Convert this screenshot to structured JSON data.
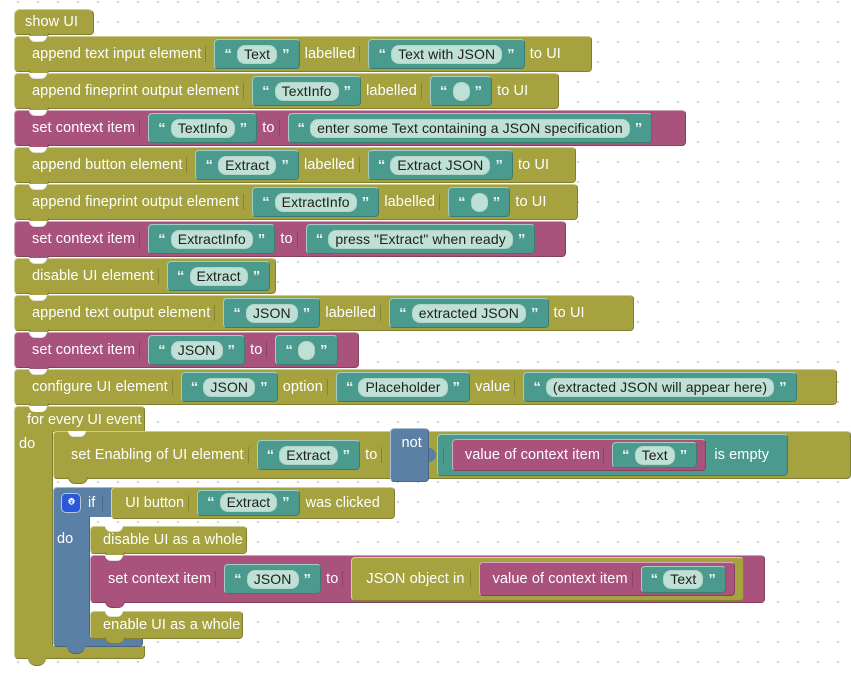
{
  "workspace": {
    "kind": "blockly-visual-program",
    "title": "show UI",
    "colors": {
      "olive": "#a5a23f",
      "magenta": "#a8527c",
      "blue": "#5b80a5",
      "teal": "#4a9b8e",
      "field": "#bfe0d5",
      "canvas": "#ffffff",
      "grid_dot": "#cfcfcf"
    }
  },
  "blocks": {
    "hat": {
      "label": "show UI"
    },
    "row_text_input": {
      "prefix": "append text input element",
      "value": "Text",
      "mid": "labelled",
      "label_value": "Text with JSON",
      "suffix": "to UI"
    },
    "row_fineprint_textinfo": {
      "prefix": "append fineprint output element",
      "value": "TextInfo",
      "mid": "labelled",
      "label_value": "",
      "suffix": "to UI"
    },
    "row_set_textinfo": {
      "prefix": "set context item",
      "value": "TextInfo",
      "mid": "to",
      "to_value": "enter some Text containing a JSON specification"
    },
    "row_button": {
      "prefix": "append button element",
      "value": "Extract",
      "mid": "labelled",
      "label_value": "Extract JSON",
      "suffix": "to UI"
    },
    "row_fineprint_extractinfo": {
      "prefix": "append fineprint output element",
      "value": "ExtractInfo",
      "mid": "labelled",
      "label_value": "",
      "suffix": "to UI"
    },
    "row_set_extractinfo": {
      "prefix": "set context item",
      "value": "ExtractInfo",
      "mid": "to",
      "to_value": "press \"Extract\" when ready"
    },
    "row_disable": {
      "prefix": "disable UI element",
      "value": "Extract"
    },
    "row_text_output": {
      "prefix": "append text output element",
      "value": "JSON",
      "mid": "labelled",
      "label_value": "extracted JSON",
      "suffix": "to UI"
    },
    "row_set_json_empty": {
      "prefix": "set context item",
      "value": "JSON",
      "mid": "to",
      "to_value": ""
    },
    "row_configure": {
      "prefix": "configure UI element",
      "value": "JSON",
      "mid": "option",
      "option_value": "Placeholder",
      "mid2": "value",
      "val_value": "(extracted JSON will appear here)"
    },
    "for_event": {
      "header": "for every UI event",
      "do_label": "do"
    },
    "row_set_enabling": {
      "prefix": "set Enabling of UI element",
      "value": "Extract",
      "mid": "to",
      "not_label": "not",
      "ctx_label": "value of context item",
      "ctx_value": "Text",
      "is_empty_label": "is empty"
    },
    "if_block": {
      "gear_icon": "gear-icon",
      "if_label": "if",
      "cond_prefix": "UI button",
      "cond_value": "Extract",
      "cond_suffix": "was clicked",
      "do_label": "do"
    },
    "row_disable_whole": {
      "label": "disable UI as a whole"
    },
    "row_set_json_obj": {
      "prefix": "set context item",
      "value": "JSON",
      "mid": "to",
      "json_obj_label": "JSON object in",
      "ctx_label": "value of context item",
      "ctx_value": "Text"
    },
    "row_enable_whole": {
      "label": "enable UI as a whole"
    }
  }
}
